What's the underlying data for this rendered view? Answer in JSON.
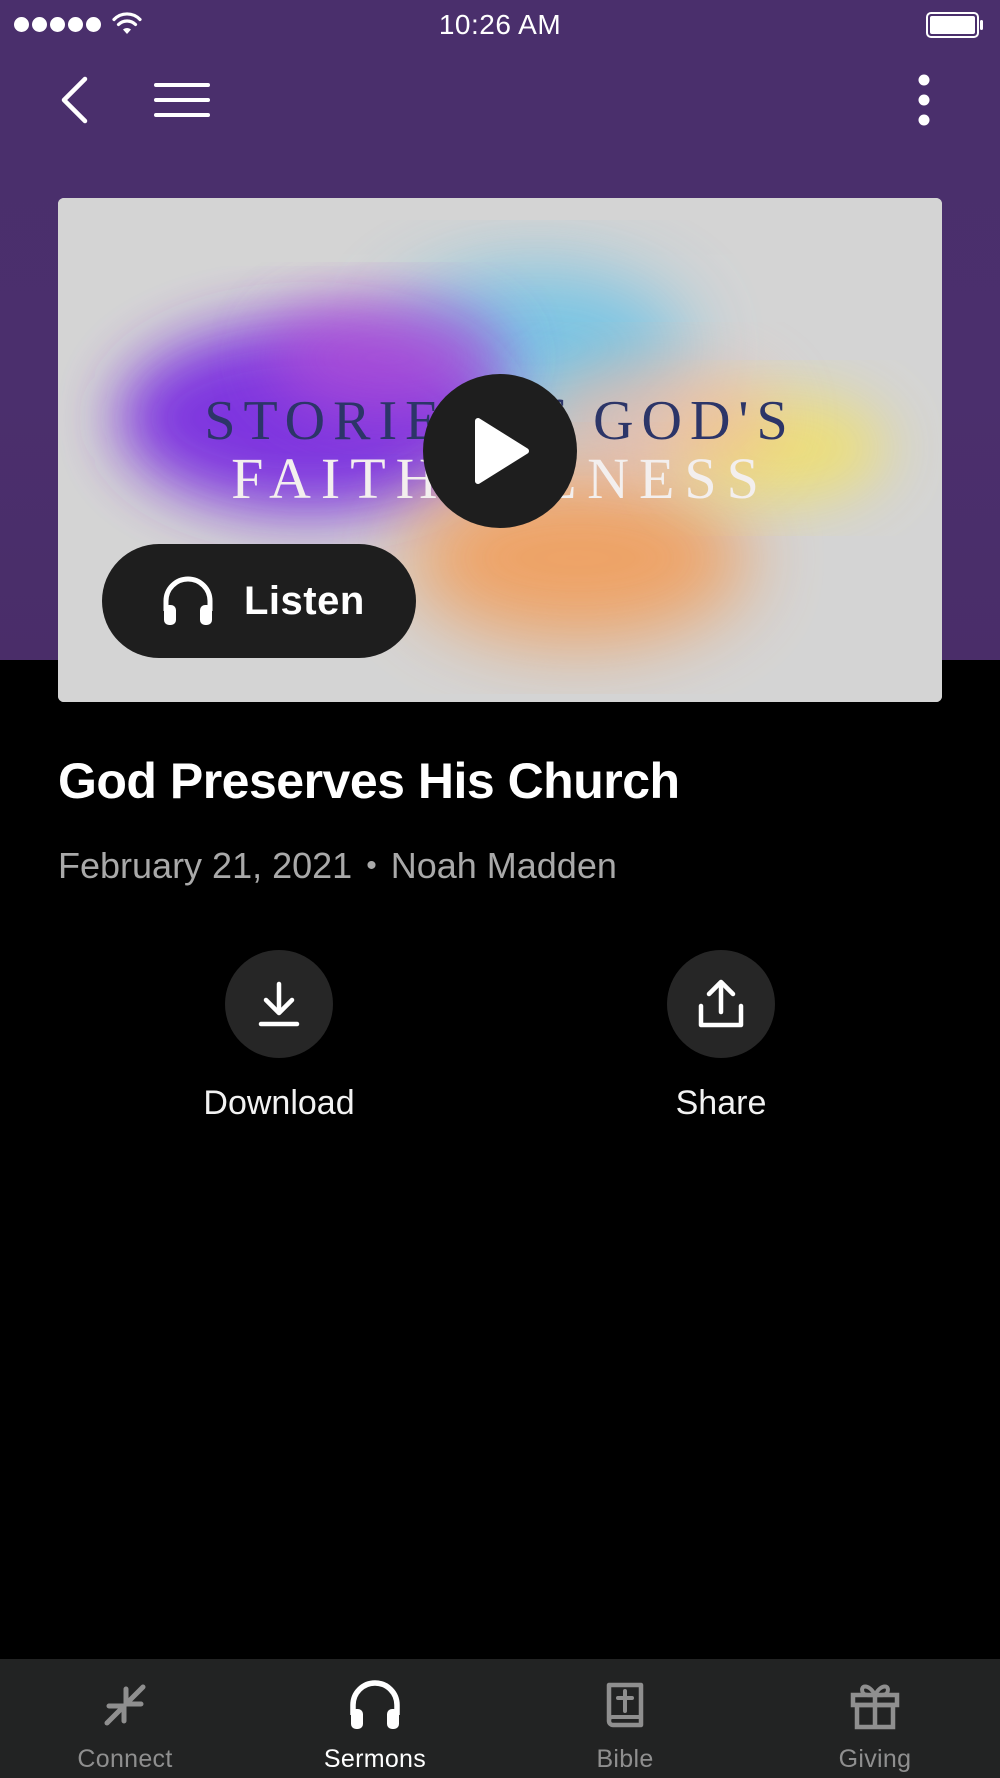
{
  "status_bar": {
    "time": "10:26 AM",
    "signal_bars": 5,
    "battery_level": 1.0
  },
  "nav": {
    "back_icon": "chevron-left-icon",
    "menu_icon": "hamburger-menu-icon",
    "more_icon": "vertical-ellipsis-icon"
  },
  "media": {
    "artwork_title_line1": "STORIES of GOD'S",
    "artwork_title_line2": "FAITHFULNESS",
    "play_icon": "play-icon",
    "listen_label": "Listen",
    "listen_icon": "headphones-icon"
  },
  "sermon": {
    "title": "God Preserves His Church",
    "date": "February 21, 2021",
    "separator": "•",
    "speaker": "Noah Madden"
  },
  "actions": [
    {
      "label": "Download",
      "icon": "download-icon"
    },
    {
      "label": "Share",
      "icon": "share-icon"
    }
  ],
  "tabs": [
    {
      "label": "Connect",
      "icon": "connect-arrows-icon",
      "active": false
    },
    {
      "label": "Sermons",
      "icon": "headphones-icon",
      "active": true
    },
    {
      "label": "Bible",
      "icon": "bible-icon",
      "active": false
    },
    {
      "label": "Giving",
      "icon": "gift-icon",
      "active": false
    }
  ],
  "colors": {
    "header_purple": "#4a2f6c",
    "background": "#000000",
    "tab_bar": "#222323",
    "button_dark": "#1e1e1e",
    "secondary_text": "#a9a9a9"
  }
}
